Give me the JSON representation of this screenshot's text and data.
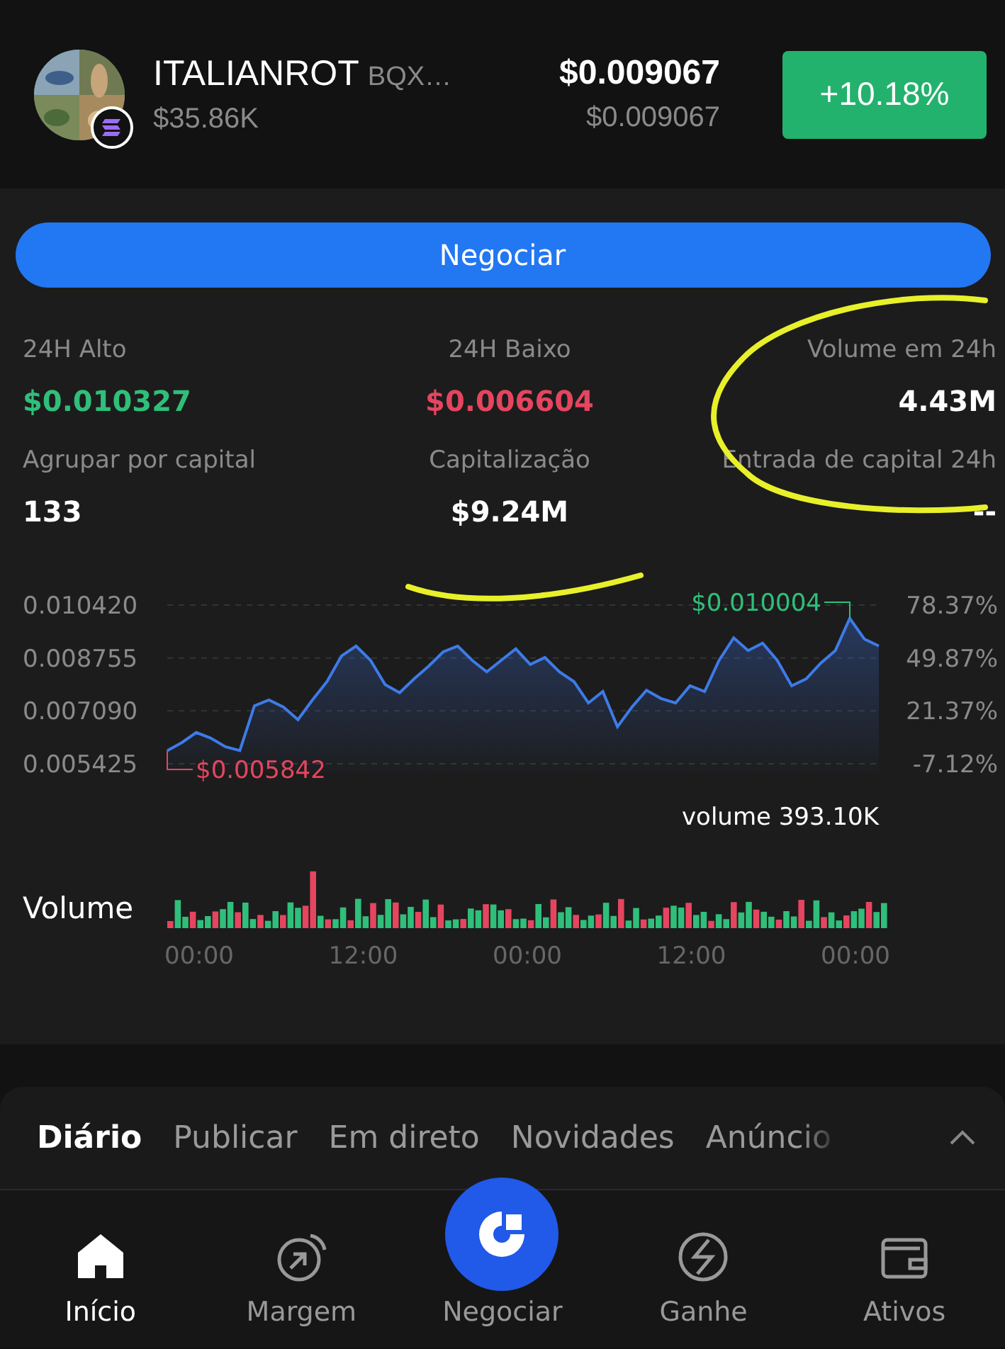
{
  "header": {
    "name": "ITALIANROT",
    "ticker": "BQX…",
    "market_cap": "$35.86K",
    "price": "$0.009067",
    "price_sub": "$0.009067",
    "change": "+10.18%"
  },
  "trade_button": "Negociar",
  "stats": [
    {
      "label": "24H Alto",
      "value": "$0.010327",
      "kind": "up"
    },
    {
      "label": "24H Baixo",
      "value": "$0.006604",
      "kind": "down"
    },
    {
      "label": "Volume em 24h",
      "value": "4.43M",
      "kind": "plain"
    },
    {
      "label": "Agrupar por capital",
      "value": "133",
      "kind": "plain"
    },
    {
      "label": "Capitalização",
      "value": "$9.24M",
      "kind": "plain"
    },
    {
      "label": "Entrada de capital 24h",
      "value": "--",
      "kind": "plain"
    }
  ],
  "price_chart": {
    "percent_labels": [
      "78.37%",
      "49.87%",
      "21.37%",
      "-7.12%"
    ],
    "chart_data": {
      "type": "area",
      "ylim": [
        0.005425,
        0.01042
      ],
      "yticks": [
        {
          "value": 0.01042,
          "label": "0.010420"
        },
        {
          "value": 0.008755,
          "label": "0.008755"
        },
        {
          "value": 0.00709,
          "label": "0.007090"
        },
        {
          "value": 0.005425,
          "label": "0.005425"
        }
      ],
      "series": [
        {
          "color": "#3d7be8",
          "values": [
            0.00584,
            0.00609,
            0.00641,
            0.00623,
            0.00596,
            0.00584,
            0.00725,
            0.00743,
            0.00721,
            0.00681,
            0.00743,
            0.00801,
            0.00882,
            0.00913,
            0.00868,
            0.00792,
            0.00766,
            0.0081,
            0.0085,
            0.00895,
            0.00913,
            0.00868,
            0.00832,
            0.00868,
            0.00904,
            0.00855,
            0.00877,
            0.00832,
            0.00801,
            0.00734,
            0.0077,
            0.00659,
            0.00721,
            0.00774,
            0.00748,
            0.00734,
            0.00788,
            0.0077,
            0.00868,
            0.00939,
            0.00899,
            0.00922,
            0.00868,
            0.00788,
            0.0081,
            0.00859,
            0.00899,
            0.01,
            0.00935,
            0.00913
          ]
        }
      ],
      "annotations": [
        "$0.010004",
        "$0.005842"
      ]
    }
  },
  "volume": {
    "reading": "volume 393.10K",
    "title": "Volume",
    "time_labels": [
      "00:00",
      "12:00",
      "00:00",
      "12:00",
      "00:00"
    ]
  },
  "feed_tabs": [
    {
      "label": "Diário",
      "selected": true
    },
    {
      "label": "Publicar",
      "selected": false
    },
    {
      "label": "Em direto",
      "selected": false
    },
    {
      "label": "Novidades",
      "selected": false
    },
    {
      "label": "Anúncio",
      "selected": false
    }
  ],
  "nav": [
    {
      "label": "Início",
      "kind": "home",
      "selected": true
    },
    {
      "label": "Margem",
      "kind": "margin",
      "selected": false
    },
    {
      "label": "Negociar",
      "kind": "trade",
      "selected": false
    },
    {
      "label": "Ganhe",
      "kind": "earn",
      "selected": false
    },
    {
      "label": "Ativos",
      "kind": "assets",
      "selected": false
    }
  ]
}
